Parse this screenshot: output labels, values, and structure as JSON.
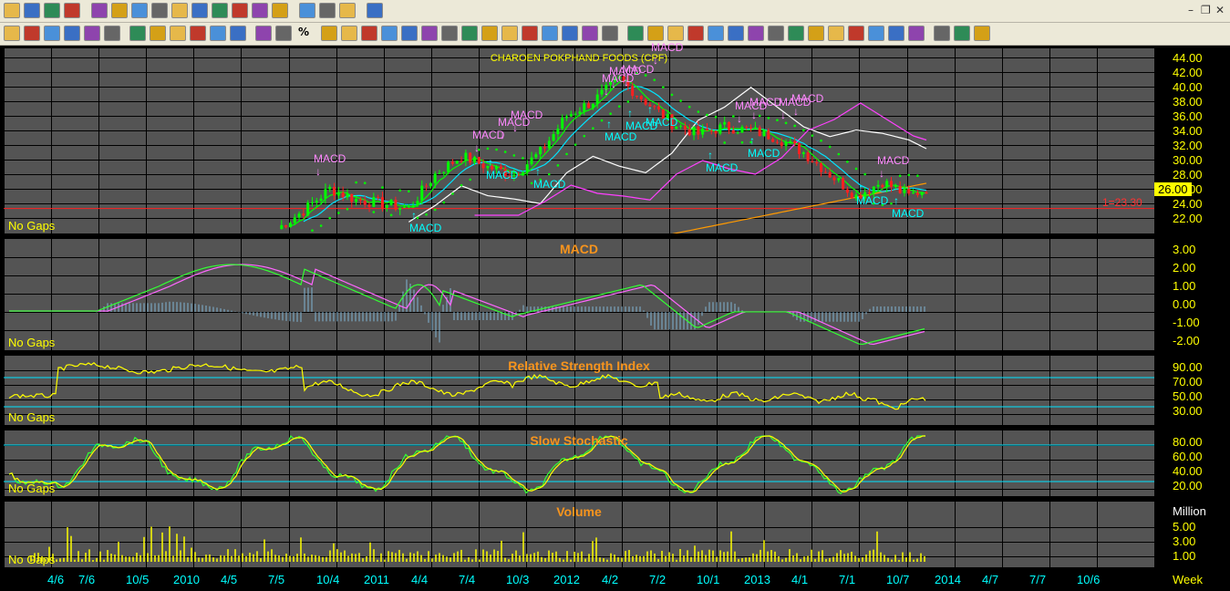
{
  "toolbar": {
    "row1": [
      "open-icon",
      "save-icon",
      "save-as-icon",
      "print-icon",
      "chart-icon",
      "table-icon",
      "quote-icon",
      "picture-icon",
      "wa-icon",
      "news-icon",
      "tick-icon",
      "function-icon",
      "check-icon",
      "alert-icon",
      "smiley-icon",
      "layout-icon",
      "export-icon",
      "grid-icon"
    ],
    "row2": [
      "move-icon",
      "home-icon",
      "text-a-icon",
      "arrows-h-icon",
      "arrows-h2-icon",
      "arrow-left-icon",
      "arrow-right-icon",
      "text-a2-icon",
      "arrows-v-icon",
      "arrows-v2-icon",
      "arrow-up-icon",
      "arrow-down-icon",
      "line-tool-icon",
      "curve-tool-icon",
      "percent-icon",
      "refresh-icon",
      "bars-icon",
      "indicator-icon",
      "indicator2-icon",
      "indicator3-icon",
      "indicator4-icon",
      "indicator5-icon",
      "close-chart-icon",
      "new-chart-icon",
      "chart-add-icon",
      "chart-edit-icon",
      "copy-icon",
      "paste-icon",
      "delete-icon",
      "page-icon",
      "pointer-icon",
      "line-icon",
      "hline-icon",
      "channel-icon",
      "trend-icon",
      "fib-icon",
      "cycle-icon",
      "text-icon",
      "callout-icon",
      "rect-icon",
      "triangle-icon",
      "ellipse-icon",
      "erase-icon",
      "delete-all-icon",
      "magnet-icon",
      "grid-toggle-icon",
      "settings-icon",
      "screen-icon"
    ],
    "percent_label": "%"
  },
  "main": {
    "title": "CHAROEN POKPHAND FOODS (CPF)",
    "y_ticks": [
      "44.00",
      "42.00",
      "40.00",
      "38.00",
      "36.00",
      "34.00",
      "32.00",
      "30.00",
      "28.00",
      "26.00",
      "24.00",
      "22.00"
    ],
    "last_price": "26.00",
    "hline_label": "1=23.30",
    "no_gaps": "No Gaps",
    "signals": [
      {
        "label": "MACD",
        "type": "sell"
      },
      {
        "label": "MACD",
        "type": "sell"
      },
      {
        "label": "MACD",
        "type": "sell"
      },
      {
        "label": "MACD",
        "type": "sell"
      },
      {
        "label": "MACD",
        "type": "sell"
      },
      {
        "label": "MACD",
        "type": "sell"
      },
      {
        "label": "MACD",
        "type": "sell"
      },
      {
        "label": "MACD",
        "type": "sell"
      },
      {
        "label": "MACD",
        "type": "sell"
      },
      {
        "label": "MACD",
        "type": "buy"
      },
      {
        "label": "MACD",
        "type": "buy"
      },
      {
        "label": "MACD",
        "type": "buy"
      },
      {
        "label": "MACD",
        "type": "buy"
      },
      {
        "label": "MACD",
        "type": "buy"
      },
      {
        "label": "MACD",
        "type": "buy"
      },
      {
        "label": "MACD",
        "type": "buy"
      },
      {
        "label": "MACD",
        "type": "buy"
      },
      {
        "label": "MACD",
        "type": "buy"
      }
    ]
  },
  "macd": {
    "title": "MACD",
    "y_ticks": [
      "3.00",
      "2.00",
      "1.00",
      "0.00",
      "-1.00",
      "-2.00"
    ],
    "no_gaps": "No Gaps"
  },
  "rsi": {
    "title": "Relative Strength Index",
    "y_ticks": [
      "90.00",
      "70.00",
      "50.00",
      "30.00"
    ],
    "no_gaps": "No Gaps"
  },
  "stoch": {
    "title": "Slow Stochastic",
    "y_ticks": [
      "80.00",
      "60.00",
      "40.00",
      "20.00"
    ],
    "no_gaps": "No Gaps"
  },
  "volume": {
    "title": "Volume",
    "unit": "Million",
    "y_ticks": [
      "5.00",
      "3.00",
      "1.00"
    ],
    "no_gaps": "No Gaps"
  },
  "x_axis": {
    "labels": [
      "4/6",
      "7/6",
      "10/5",
      "2010",
      "4/5",
      "7/5",
      "10/4",
      "2011",
      "4/4",
      "7/4",
      "10/3",
      "2012",
      "4/2",
      "7/2",
      "10/1",
      "2013",
      "4/1",
      "7/1",
      "10/7",
      "2014",
      "4/7",
      "7/7",
      "10/6"
    ],
    "period": "Week"
  },
  "colors": {
    "panel_bg": "#545454",
    "up": "#00ff00",
    "down": "#ff2020",
    "ma_white": "#ffffff",
    "ma_magenta": "#ff40ff",
    "ma_orange": "#ff9900",
    "ma_cyan": "#00e5ff",
    "ma_green": "#00ff00",
    "yellow": "#ffff00",
    "title_orange": "#f7941d"
  }
}
